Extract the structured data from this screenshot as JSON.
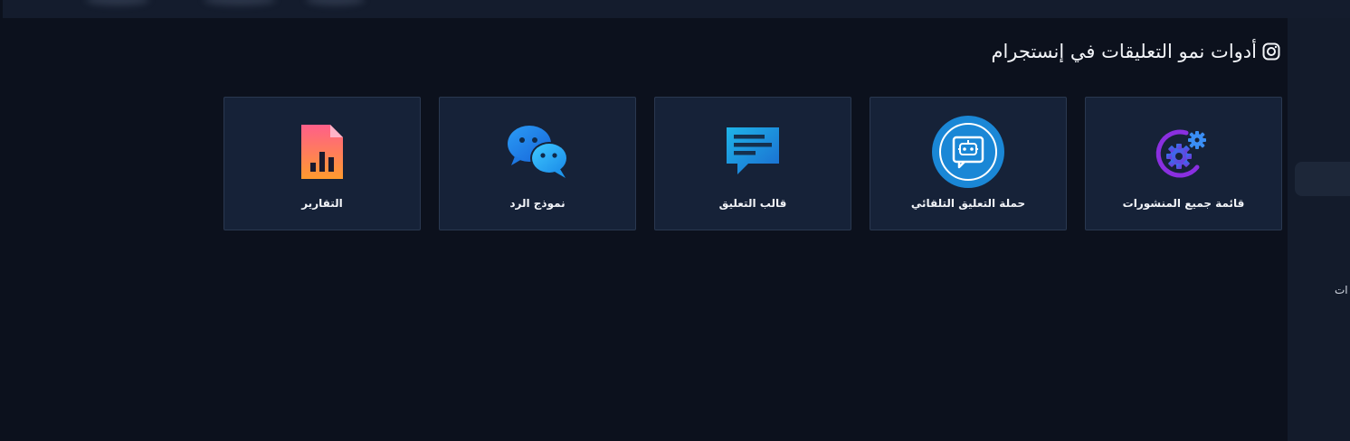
{
  "page": {
    "section_title": "أدوات نمو التعليقات في إنستجرام",
    "section_icon": "instagram-icon"
  },
  "tools": [
    {
      "label": "قائمة جميع المنشورات",
      "icon": "gears-icon"
    },
    {
      "label": "حملة التعليق التلقائي",
      "icon": "robot-chat-icon"
    },
    {
      "label": "قالب التعليق",
      "icon": "comment-template-icon"
    },
    {
      "label": "نموذج الرد",
      "icon": "reply-chat-icon"
    },
    {
      "label": "التقارير",
      "icon": "report-chart-icon"
    }
  ],
  "sidebar": {
    "partial_label": "ات"
  },
  "colors": {
    "background": "#0c111d",
    "card": "#162238",
    "card_border": "#2a3850",
    "sidebar": "#131b2b"
  }
}
